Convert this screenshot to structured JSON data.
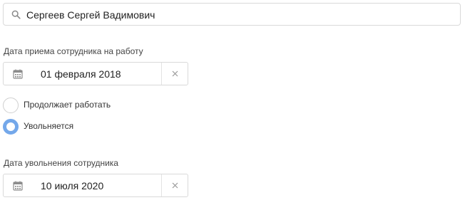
{
  "search": {
    "value": "Сергеев Сергей Вадимович",
    "icon": "search-icon"
  },
  "hire_date": {
    "label": "Дата приема сотрудника на работу",
    "value": "01 февраля 2018",
    "icon": "calendar-icon",
    "clear_icon": "close-icon"
  },
  "employment_status": {
    "options": [
      {
        "label": "Продолжает работать",
        "selected": false
      },
      {
        "label": "Увольняется",
        "selected": true
      }
    ],
    "accent_color": "#74a8ea"
  },
  "dismissal_date": {
    "label": "Дата увольнения сотрудника",
    "value": "10 июля 2020",
    "icon": "calendar-icon",
    "clear_icon": "close-icon"
  }
}
